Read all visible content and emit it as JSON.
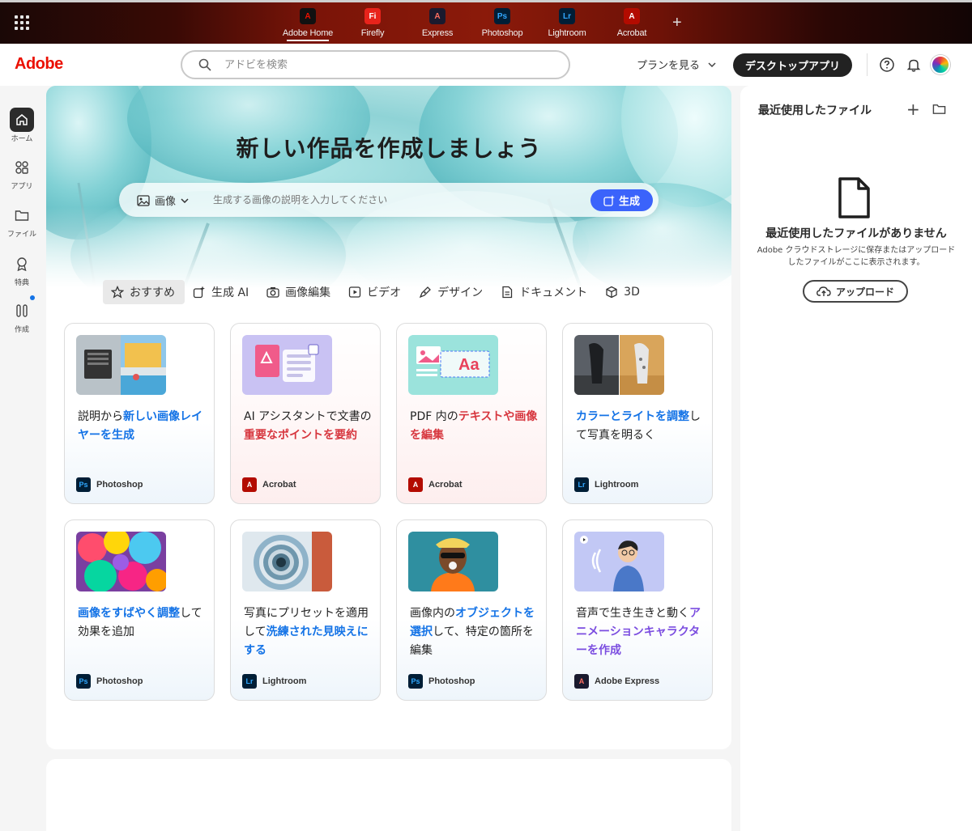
{
  "top_apps": [
    {
      "label": "Adobe Home",
      "glyph": "A",
      "bg": "#111111",
      "fg": "#eb1000",
      "active": true
    },
    {
      "label": "Firefly",
      "glyph": "Fi",
      "bg": "#e8231b",
      "fg": "#ffffff"
    },
    {
      "label": "Express",
      "glyph": "A",
      "bg": "#1a1a2e",
      "fg": "#ff6f61"
    },
    {
      "label": "Photoshop",
      "glyph": "Ps",
      "bg": "#001e36",
      "fg": "#31a8ff"
    },
    {
      "label": "Lightroom",
      "glyph": "Lr",
      "bg": "#001e36",
      "fg": "#31a8ff"
    },
    {
      "label": "Acrobat",
      "glyph": "A",
      "bg": "#b30b00",
      "fg": "#ffffff"
    }
  ],
  "top_plus": "+",
  "header": {
    "logo": "Adobe",
    "search_placeholder": "アドビを検索",
    "plans": "プランを見る",
    "desktop_apps": "デスクトップアプリ"
  },
  "rail": [
    {
      "label": "ホーム",
      "icon": "home-icon"
    },
    {
      "label": "アプリ",
      "icon": "apps-icon"
    },
    {
      "label": "ファイル",
      "icon": "folder-icon"
    },
    {
      "label": "特典",
      "icon": "award-icon"
    },
    {
      "label": "作成",
      "icon": "create-icon"
    }
  ],
  "hero": {
    "title": "新しい作品を作成しましょう",
    "type_label": "画像",
    "prompt_placeholder": "生成する画像の説明を入力してください",
    "generate": "生成"
  },
  "categories": [
    "おすすめ",
    "生成 AI",
    "画像編集",
    "ビデオ",
    "デザイン",
    "ドキュメント",
    "3D"
  ],
  "cards": [
    {
      "parts": [
        [
          "説明から",
          ""
        ],
        [
          "新しい画像レイヤーを生成",
          "hl"
        ]
      ],
      "app": "Photoshop",
      "app_glyph": "Ps"
    },
    {
      "parts": [
        [
          "AI アシスタントで文書の",
          ""
        ],
        [
          "重要なポイントを要約",
          "hl red"
        ]
      ],
      "app": "Acrobat",
      "app_glyph": "A"
    },
    {
      "parts": [
        [
          "PDF 内の",
          ""
        ],
        [
          "テキストや画像を編集",
          "hl red"
        ]
      ],
      "app": "Acrobat",
      "app_glyph": "A"
    },
    {
      "parts": [
        [
          "カラーとライトを調整",
          "hl"
        ],
        [
          "して写真を明るく",
          ""
        ]
      ],
      "app": "Lightroom",
      "app_glyph": "Lr"
    },
    {
      "parts": [
        [
          "画像をすばやく調整",
          "hl"
        ],
        [
          "して効果を追加",
          ""
        ]
      ],
      "app": "Photoshop",
      "app_glyph": "Ps"
    },
    {
      "parts": [
        [
          "写真にプリセットを適用して",
          ""
        ],
        [
          "洗練された見映えにする",
          "hl"
        ]
      ],
      "app": "Lightroom",
      "app_glyph": "Lr"
    },
    {
      "parts": [
        [
          "画像内の",
          ""
        ],
        [
          "オブジェクトを選択",
          "hl"
        ],
        [
          "して、特定の箇所を編集",
          ""
        ]
      ],
      "app": "Photoshop",
      "app_glyph": "Ps"
    },
    {
      "parts": [
        [
          "音声で生き生きと動く",
          ""
        ],
        [
          "アニメーションキャラクターを作成",
          "hl purple"
        ]
      ],
      "app": "Adobe Express",
      "app_glyph": "A"
    }
  ],
  "recent": {
    "title": "最近使用したファイル",
    "add": "+",
    "empty_title": "最近使用したファイルがありません",
    "empty_desc": "Adobe クラウドストレージに保存またはアップロードしたファイルがここに表示されます。",
    "upload": "アップロード"
  },
  "colors": {
    "adobe_red": "#eb1000",
    "accent_blue": "#1473e6",
    "generate_blue": "#3b63fb"
  }
}
